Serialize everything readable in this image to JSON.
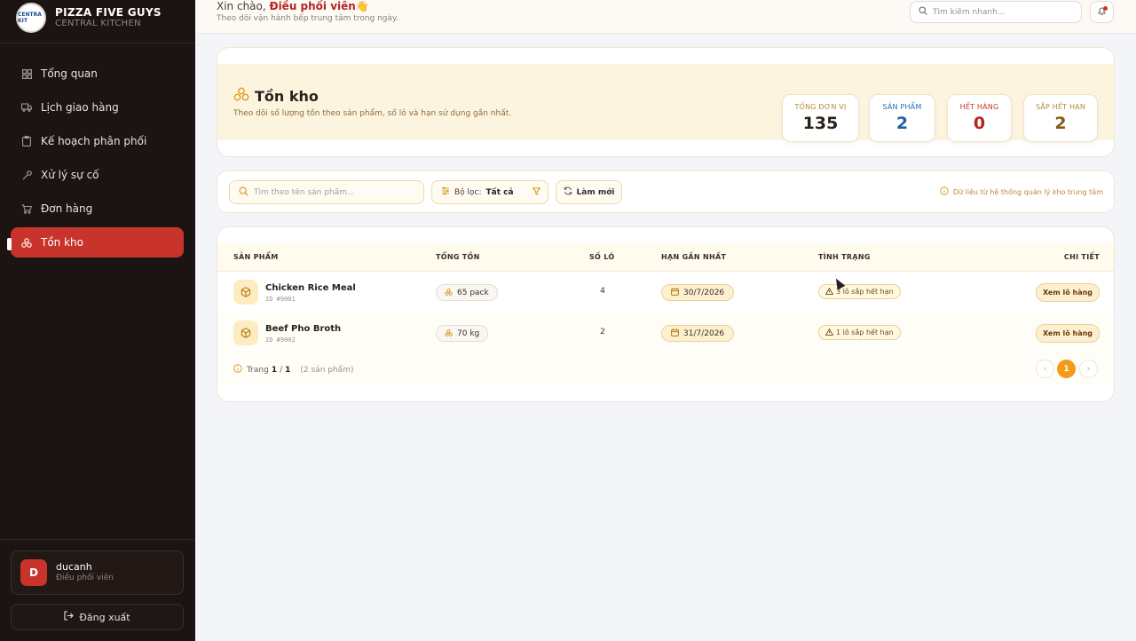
{
  "brand": {
    "name": "PIZZA FIVE GUYS",
    "sub": "CENTRAL KITCHEN",
    "logo_text": "CENTRA KIT"
  },
  "nav": [
    {
      "label": "Tổng quan",
      "icon": "grid-icon"
    },
    {
      "label": "Lịch giao hàng",
      "icon": "truck-icon"
    },
    {
      "label": "Kế hoạch phân phối",
      "icon": "clipboard-icon"
    },
    {
      "label": "Xử lý sự cố",
      "icon": "wrench-icon"
    },
    {
      "label": "Đơn hàng",
      "icon": "cart-icon"
    },
    {
      "label": "Tồn kho",
      "icon": "boxes-icon",
      "active": true
    }
  ],
  "user": {
    "initial": "D",
    "name": "ducanh",
    "role": "Điều phối viên"
  },
  "logout_label": "Đăng xuất",
  "topbar": {
    "greeting_prefix": "Xin chào, ",
    "greeting_role": "Điều phối viên",
    "greeting_emoji": "👋",
    "subtitle": "Theo dõi vận hành bếp trung tâm trong ngày.",
    "search_placeholder": "Tìm kiếm nhanh..."
  },
  "header": {
    "title": "Tồn kho",
    "subtitle": "Theo dõi số lượng tồn theo sản phẩm, số lô và hạn sử dụng gần nhất.",
    "stats": [
      {
        "label": "TỔNG ĐƠN VỊ",
        "value": "135",
        "color": "#2a2118",
        "label_color": "#b88a3a"
      },
      {
        "label": "SẢN PHẨM",
        "value": "2",
        "color": "#1f5fa8",
        "label_color": "#1f6fb8"
      },
      {
        "label": "HẾT HÀNG",
        "value": "0",
        "color": "#b5261e",
        "label_color": "#c8342c"
      },
      {
        "label": "SẮP HẾT HẠN",
        "value": "2",
        "color": "#8a5a12",
        "label_color": "#b88a3a"
      }
    ]
  },
  "filters": {
    "search_placeholder": "Tìm theo tên sản phẩm...",
    "filter_label": "Bộ lọc:",
    "filter_value": "Tất cả",
    "refresh_label": "Làm mới",
    "note": "Dữ liệu từ hệ thống quản lý kho trung tâm"
  },
  "table": {
    "columns": [
      "SẢN PHẨM",
      "TỔNG TỒN",
      "SỐ LÔ",
      "HẠN GẦN NHẤT",
      "TÌNH TRẠNG",
      "CHI TIẾT"
    ],
    "rows": [
      {
        "name": "Chicken Rice Meal",
        "id": "ID #9001",
        "qty": "65 pack",
        "lots": "4",
        "expiry": "30/7/2026",
        "status": "3 lô sắp hết hạn",
        "action": "Xem lô hàng"
      },
      {
        "name": "Beef Pho Broth",
        "id": "ID #9002",
        "qty": "70 kg",
        "lots": "2",
        "expiry": "31/7/2026",
        "status": "1 lô sắp hết hạn",
        "action": "Xem lô hàng"
      }
    ]
  },
  "pagination": {
    "label": "Trang",
    "current": "1",
    "separator": "/",
    "total": "1",
    "count": "(2 sản phẩm)",
    "prev": "‹",
    "next": "›"
  },
  "colors": {
    "accent": "#c8342c",
    "sidebar_bg": "#1c1412",
    "amber": "#f39a1a"
  }
}
